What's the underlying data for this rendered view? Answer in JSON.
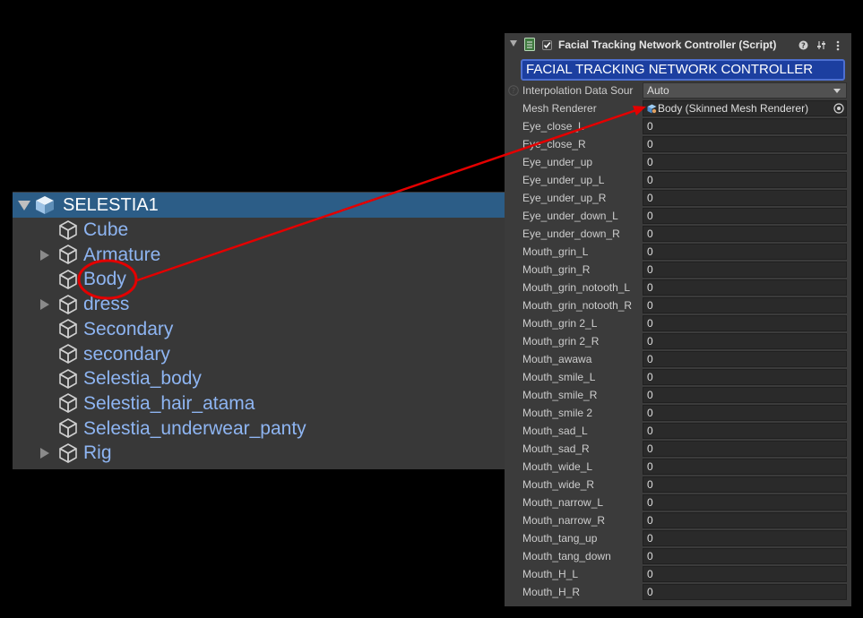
{
  "hierarchy": {
    "root": {
      "label": "SELESTIA1",
      "icon": "prefab-cube-icon"
    },
    "items": [
      {
        "label": "Cube",
        "icon": "gameobject-cube-icon",
        "expandable": false
      },
      {
        "label": "Armature",
        "icon": "gameobject-cube-icon",
        "expandable": true
      },
      {
        "label": "Body",
        "icon": "gameobject-cube-icon",
        "expandable": false,
        "highlighted": true
      },
      {
        "label": "dress",
        "icon": "gameobject-cube-icon",
        "expandable": true
      },
      {
        "label": "Secondary",
        "icon": "gameobject-cube-icon",
        "expandable": false
      },
      {
        "label": "secondary",
        "icon": "gameobject-cube-icon",
        "expandable": false
      },
      {
        "label": "Selestia_body",
        "icon": "gameobject-cube-icon",
        "expandable": false
      },
      {
        "label": "Selestia_hair_atama",
        "icon": "gameobject-cube-icon",
        "expandable": false
      },
      {
        "label": "Selestia_underwear_panty",
        "icon": "gameobject-cube-icon",
        "expandable": false
      },
      {
        "label": "Rig",
        "icon": "gameobject-cube-icon",
        "expandable": true
      }
    ]
  },
  "inspector": {
    "component_title": "Facial Tracking Network Controller (Script)",
    "banner": "FACIAL TRACKING NETWORK CONTROLLER",
    "interpolation_label": "Interpolation Data Sour",
    "interpolation_value": "Auto",
    "mesh_renderer_label": "Mesh Renderer",
    "mesh_renderer_value": "Body (Skinned Mesh Renderer)",
    "blendshapes": [
      {
        "label": "Eye_close_L",
        "value": "0"
      },
      {
        "label": "Eye_close_R",
        "value": "0"
      },
      {
        "label": "Eye_under_up",
        "value": "0"
      },
      {
        "label": "Eye_under_up_L",
        "value": "0"
      },
      {
        "label": "Eye_under_up_R",
        "value": "0"
      },
      {
        "label": "Eye_under_down_L",
        "value": "0"
      },
      {
        "label": "Eye_under_down_R",
        "value": "0"
      },
      {
        "label": "Mouth_grin_L",
        "value": "0"
      },
      {
        "label": "Mouth_grin_R",
        "value": "0"
      },
      {
        "label": "Mouth_grin_notooth_L",
        "value": "0"
      },
      {
        "label": "Mouth_grin_notooth_R",
        "value": "0"
      },
      {
        "label": "Mouth_grin 2_L",
        "value": "0"
      },
      {
        "label": "Mouth_grin 2_R",
        "value": "0"
      },
      {
        "label": "Mouth_awawa",
        "value": "0"
      },
      {
        "label": "Mouth_smile_L",
        "value": "0"
      },
      {
        "label": "Mouth_smile_R",
        "value": "0"
      },
      {
        "label": "Mouth_smile 2",
        "value": "0"
      },
      {
        "label": "Mouth_sad_L",
        "value": "0"
      },
      {
        "label": "Mouth_sad_R",
        "value": "0"
      },
      {
        "label": "Mouth_wide_L",
        "value": "0"
      },
      {
        "label": "Mouth_wide_R",
        "value": "0"
      },
      {
        "label": "Mouth_narrow_L",
        "value": "0"
      },
      {
        "label": "Mouth_narrow_R",
        "value": "0"
      },
      {
        "label": "Mouth_tang_up",
        "value": "0"
      },
      {
        "label": "Mouth_tang_down",
        "value": "0"
      },
      {
        "label": "Mouth_H_L",
        "value": "0"
      },
      {
        "label": "Mouth_H_R",
        "value": "0"
      }
    ]
  },
  "colors": {
    "selection_blue": "#2c5d87",
    "hierarchy_text": "#8eb5f2",
    "banner_blue": "#1c3fa0",
    "annotation_red": "#e30000"
  }
}
